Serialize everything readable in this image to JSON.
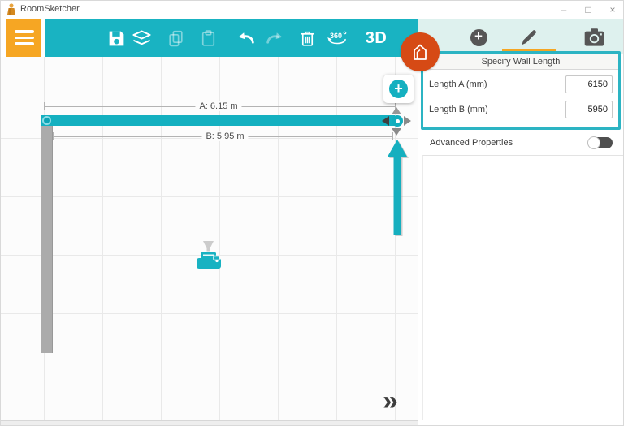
{
  "window": {
    "title": "RoomSketcher",
    "controls": {
      "minimize": "–",
      "maximize": "□",
      "close": "×"
    }
  },
  "toolbar": {
    "labels": {
      "rotate_360": "360",
      "view_3d": "3D"
    }
  },
  "canvas": {
    "dimension_a": "A: 6.15 m",
    "dimension_b": "B: 5.95 m",
    "add_button_glyph": "+",
    "expand_glyph": "»"
  },
  "panel": {
    "tabs": {
      "add_glyph": "+"
    },
    "specify": {
      "title": "Specify Wall Length",
      "fields": [
        {
          "label": "Length A (mm)",
          "value": "6150"
        },
        {
          "label": "Length B (mm)",
          "value": "5950"
        }
      ]
    },
    "advanced": {
      "label": "Advanced Properties",
      "enabled": false
    }
  },
  "colors": {
    "toolbar_teal": "#19b3c2",
    "accent_orange": "#f6a623",
    "house_button_red": "#d64a15",
    "panel_header_teal": "#def1ee",
    "wall_selected_teal": "#14b0c0",
    "wall_gray": "#ababab",
    "highlight_border": "#2cb4c3"
  }
}
